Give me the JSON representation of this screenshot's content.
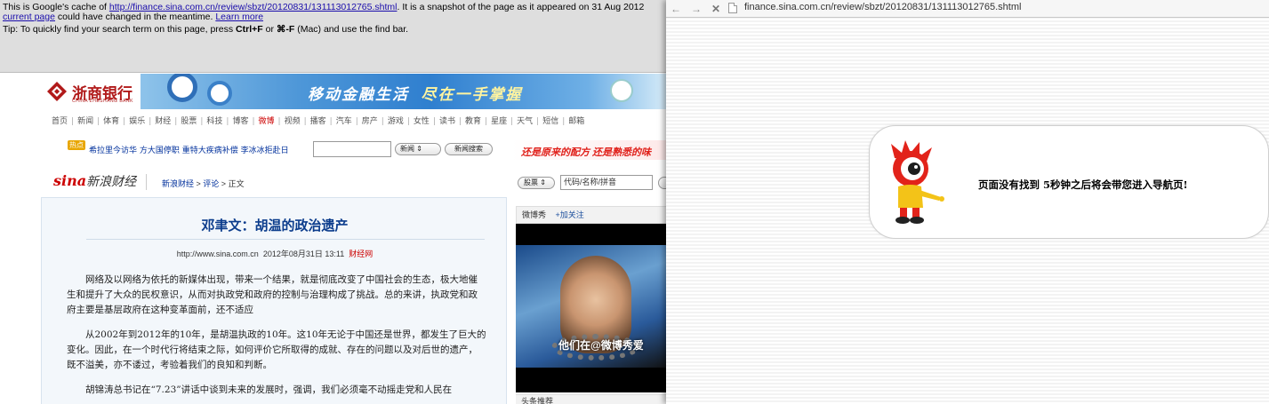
{
  "cache_notice": {
    "line1_prefix": "This is Google's cache of ",
    "cached_url": "http://finance.sina.com.cn/review/sbzt/20120831/131113012765.shtml",
    "line1_suffix": ". It is a snapshot of the page as it appeared on 31 Aug 2012",
    "current_page_link": "current page",
    "line2_middle": " could have changed in the meantime. ",
    "learn_more_link": "Learn more",
    "tip_prefix": "Tip: To quickly find your search term on this page, press ",
    "tip_key1": "Ctrl+F",
    "tip_or": " or ",
    "tip_key2": "⌘-F",
    "tip_suffix": " (Mac) and use the find bar."
  },
  "bank_ad": {
    "bank_name": "浙商银行",
    "bank_subname": "CHINA ZHESHANG BANK",
    "slogan_part1": "移动金融生活",
    "slogan_part2": "尽在一手掌握"
  },
  "nav": {
    "items": [
      "首页",
      "新闻",
      "体育",
      "娱乐",
      "财经",
      "股票",
      "科技",
      "博客",
      "微博",
      "视频",
      "播客",
      "汽车",
      "房产",
      "游戏",
      "女性",
      "读书",
      "教育",
      "星座",
      "天气",
      "短信",
      "邮箱"
    ],
    "highlight_index": 8
  },
  "hot_bar": {
    "badge": "热点",
    "links": "希拉里今访华 方大国停职 重特大疾病补偿 李冰冰拒赴日",
    "search_value": "",
    "select_value": "新闻",
    "search_button": "新闻搜索",
    "slogan": "还是原来的配方 还是熟悉的味"
  },
  "section_header": {
    "logo_text": "sina",
    "logo_cn": "新浪财经",
    "crumb_1": "新浪财经",
    "crumb_sep_1": " > ",
    "crumb_2": "评论",
    "crumb_sep_2": " > ",
    "crumb_3": "正文",
    "stock_select": "股票",
    "stock_input": "代码/名称/拼音"
  },
  "article": {
    "title": "邓聿文：胡温的政治遗产",
    "meta_source_url": "http://www.sina.com.cn",
    "meta_datetime": "2012年08月31日 13:11",
    "meta_outlet": "财经网",
    "paragraphs": [
      "网络及以网络为依托的新媒体出现，带来一个结果，就是彻底改变了中国社会的生态，极大地催生和提升了大众的民权意识，从而对执政党和政府的控制与治理构成了挑战。总的来讲，执政党和政府主要是基层政府在这种变革面前，还不适应",
      "从2002年到2012年的10年，是胡温执政的10年。这10年无论于中国还是世界，都发生了巨大的变化。因此，在一个时代行将结束之际，如何评价它所取得的成就、存在的问题以及对后世的遗产，既不溢美，亦不诿过，考验着我们的良知和判断。",
      "胡锦涛总书记在“7.23”讲话中谈到未来的发展时，强调，我们必须毫不动摇走党和人民在"
    ]
  },
  "weibo": {
    "title": "微博秀",
    "follow": "加关注",
    "video_caption": "他们在@微博秀爱",
    "next_section": "头条推荐"
  },
  "browser": {
    "back": "←",
    "forward": "→",
    "stop": "✕",
    "url": "finance.sina.com.cn/review/sbzt/20120831/131113012765.shtml"
  },
  "not_found": {
    "message": "页面没有找到 5秒钟之后将会带您进入导航页!"
  },
  "colors": {
    "link_blue": "#1a0dab",
    "sina_red": "#cc0000",
    "title_blue": "#0b3c8c"
  }
}
